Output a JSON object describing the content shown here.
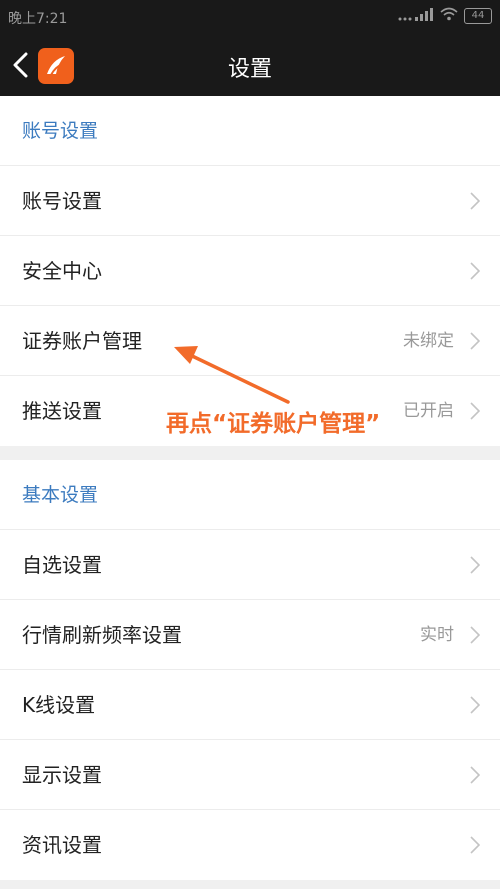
{
  "statusbar": {
    "time": "晚上7:21",
    "signal_icon": "signal-icon",
    "wifi_icon": "wifi-icon",
    "battery_level": "44"
  },
  "navbar": {
    "title": "设置",
    "back_icon": "chevron-left-icon",
    "logo_icon": "app-logo",
    "logo_color": "#f0601c"
  },
  "sections": [
    {
      "header": "账号设置",
      "rows": [
        {
          "label": "账号设置",
          "value": ""
        },
        {
          "label": "安全中心",
          "value": ""
        },
        {
          "label": "证券账户管理",
          "value": "未绑定"
        },
        {
          "label": "推送设置",
          "value": "已开启"
        }
      ]
    },
    {
      "header": "基本设置",
      "rows": [
        {
          "label": "自选设置",
          "value": ""
        },
        {
          "label": "行情刷新频率设置",
          "value": "实时"
        },
        {
          "label": "K线设置",
          "value": ""
        },
        {
          "label": "显示设置",
          "value": ""
        },
        {
          "label": "资讯设置",
          "value": ""
        }
      ]
    }
  ],
  "annotation": {
    "text": "再点“证券账户管理”",
    "color": "#f26b2a"
  },
  "colors": {
    "header_blue": "#3c7bbf",
    "bar_dark": "#191919",
    "value_gray": "#999999"
  }
}
